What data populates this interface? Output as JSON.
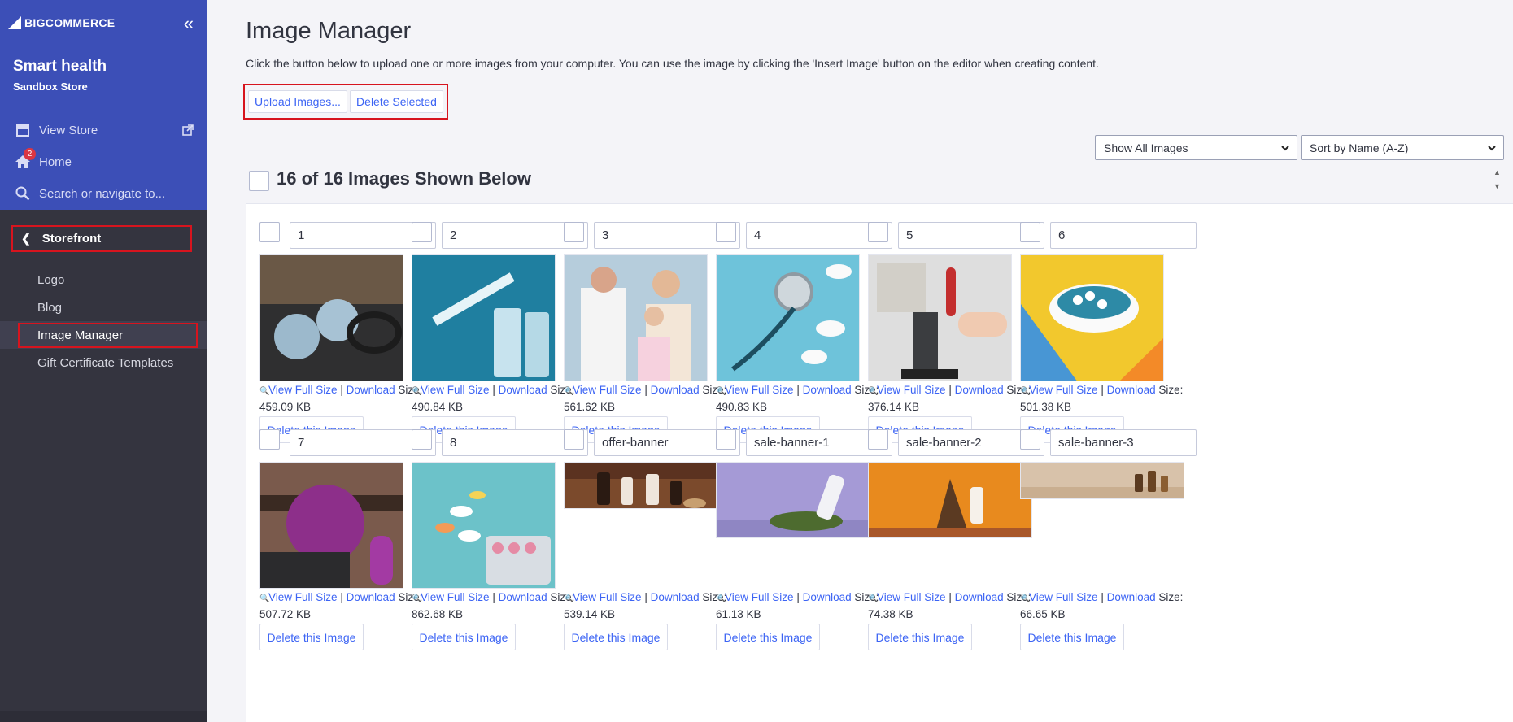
{
  "sidebar": {
    "brand": "BIGCOMMERCE",
    "store_name": "Smart health",
    "store_type": "Sandbox Store",
    "view_store": "View Store",
    "home": "Home",
    "home_badge": "2",
    "search": "Search or navigate to...",
    "section": "Storefront",
    "items": [
      {
        "label": "Logo"
      },
      {
        "label": "Blog"
      },
      {
        "label": "Image Manager"
      },
      {
        "label": "Gift Certificate Templates"
      }
    ]
  },
  "page": {
    "title": "Image Manager",
    "description": "Click the button below to upload one or more images from your computer. You can use the image by clicking the 'Insert Image' button on the editor when creating content.",
    "upload_label": "Upload Images...",
    "delete_selected_label": "Delete Selected",
    "filter_select": "Show All Images",
    "sort_select": "Sort by Name (A-Z)",
    "shown_text": "16 of 16 Images Shown Below"
  },
  "labels": {
    "view": "View Full Size",
    "sep": "|",
    "download": "Download",
    "size": "Size:",
    "delete": "Delete this Image"
  },
  "images": [
    {
      "name": "1",
      "size": "459.09 KB",
      "thumb": "resistance-bands-balls"
    },
    {
      "name": "2",
      "size": "490.84 KB",
      "thumb": "syringe-vials"
    },
    {
      "name": "3",
      "size": "561.62 KB",
      "thumb": "doctor-child"
    },
    {
      "name": "4",
      "size": "490.83 KB",
      "thumb": "stethoscope-pills"
    },
    {
      "name": "5",
      "size": "376.14 KB",
      "thumb": "microscope-test-tube"
    },
    {
      "name": "6",
      "size": "501.38 KB",
      "thumb": "pill-cup"
    },
    {
      "name": "7",
      "size": "507.72 KB",
      "thumb": "yoga-ball"
    },
    {
      "name": "8",
      "size": "862.68 KB",
      "thumb": "pills-blister"
    },
    {
      "name": "offer-banner",
      "size": "539.14 KB",
      "thumb": "bottles-banner"
    },
    {
      "name": "sale-banner-1",
      "size": "61.13 KB",
      "thumb": "bottle-moss-banner"
    },
    {
      "name": "sale-banner-2",
      "size": "74.38 KB",
      "thumb": "orange-driftwood-banner"
    },
    {
      "name": "sale-banner-3",
      "size": "66.65 KB",
      "thumb": "beige-dropper-banner"
    }
  ]
}
